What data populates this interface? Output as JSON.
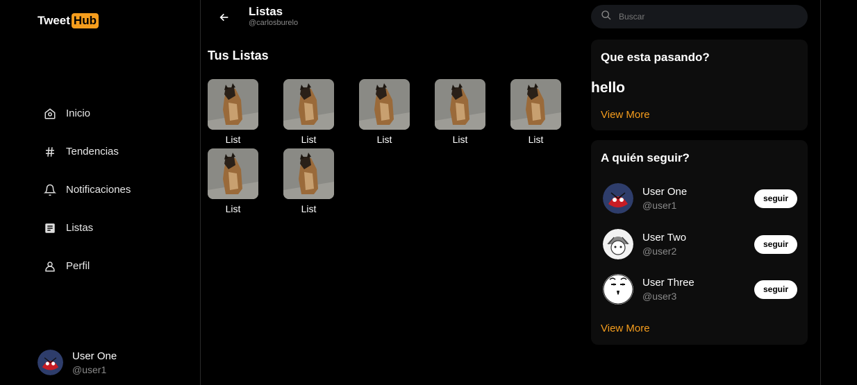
{
  "brand": {
    "part1": "Tweet",
    "part2": "Hub",
    "accent": "#f59d1d"
  },
  "nav": [
    {
      "label": "Inicio",
      "icon": "home-icon"
    },
    {
      "label": "Tendencias",
      "icon": "hashtag-icon"
    },
    {
      "label": "Notificaciones",
      "icon": "bell-icon"
    },
    {
      "label": "Listas",
      "icon": "list-icon"
    },
    {
      "label": "Perfil",
      "icon": "user-icon"
    }
  ],
  "account": {
    "name": "User One",
    "handle": "@user1"
  },
  "header": {
    "title": "Listas",
    "subtitle": "@carlosburelo"
  },
  "section_title": "Tus Listas",
  "lists": [
    {
      "label": "List"
    },
    {
      "label": "List"
    },
    {
      "label": "List"
    },
    {
      "label": "List"
    },
    {
      "label": "List"
    },
    {
      "label": "List"
    },
    {
      "label": "List"
    }
  ],
  "search": {
    "placeholder": "Buscar"
  },
  "whats_happening": {
    "title": "Que esta pasando?",
    "content": "hello",
    "view_more": "View More"
  },
  "who_to_follow": {
    "title": "A quién seguir?",
    "users": [
      {
        "name": "User One",
        "handle": "@user1",
        "button": "seguir"
      },
      {
        "name": "User Two",
        "handle": "@user2",
        "button": "seguir"
      },
      {
        "name": "User Three",
        "handle": "@user3",
        "button": "seguir"
      }
    ],
    "view_more": "View More"
  }
}
